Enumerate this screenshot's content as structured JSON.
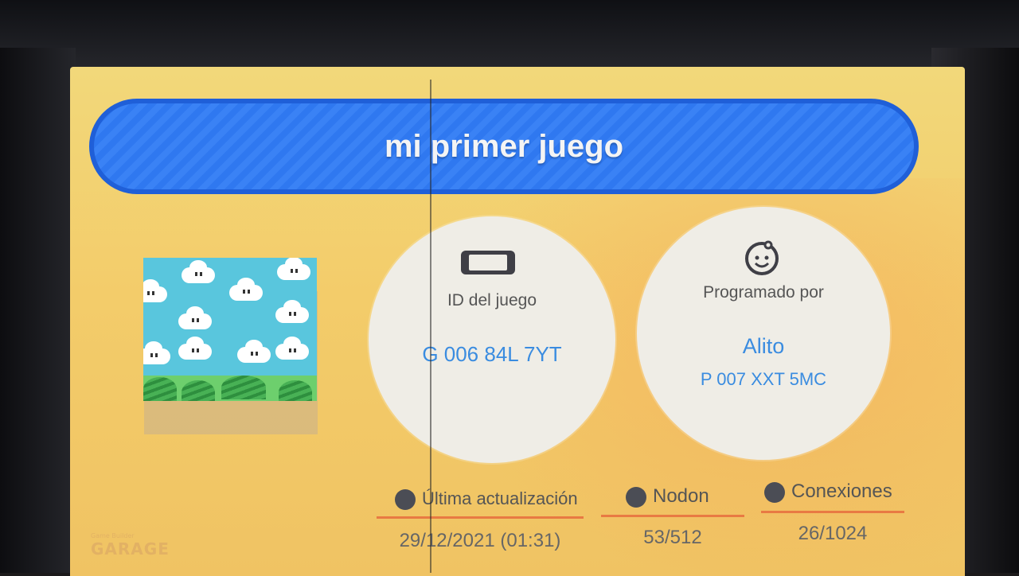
{
  "game": {
    "title": "mi primer juego"
  },
  "game_id": {
    "icon": "switch-console-icon",
    "label": "ID del juego",
    "value": "G 006 84L 7YT"
  },
  "programmer": {
    "icon": "smiley-face-icon",
    "label": "Programado por",
    "name": "Alito",
    "id": "P 007 XXT 5MC"
  },
  "stats": {
    "last_update": {
      "icon": "refresh-icon",
      "label": "Última actualización",
      "value": "29/12/2021 (01:31)"
    },
    "nodon": {
      "icon": "nodon-icon",
      "label": "Nodon",
      "value": "53/512"
    },
    "connections": {
      "icon": "connections-icon",
      "label": "Conexiones",
      "value": "26/1024"
    }
  },
  "logo": {
    "small": "Game Builder",
    "big": "GARAGE"
  },
  "colors": {
    "title_bar": "#2f78f0",
    "background": "#f2d87a",
    "accent_line": "#e87a43",
    "value_blue": "#3a8ce0"
  }
}
